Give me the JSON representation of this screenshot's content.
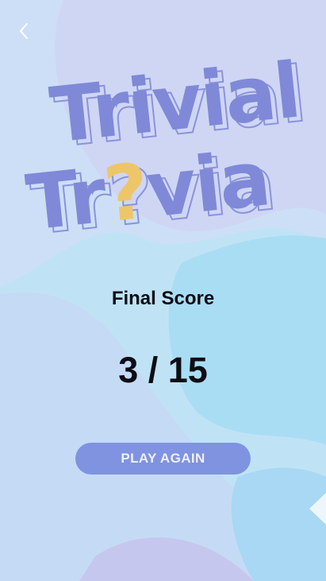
{
  "nav": {
    "back_icon": "chevron-left-icon"
  },
  "logo": {
    "line1": "Trivial",
    "line2_prefix": "Tr",
    "line2_mark": "?",
    "line2_suffix": "via"
  },
  "result": {
    "label": "Final Score",
    "score": "3 / 15"
  },
  "actions": {
    "play_again_label": "PLAY AGAIN"
  },
  "colors": {
    "logo_purple": "#7f89d8",
    "question_mark_yellow": "#edc66a",
    "button_fill": "#7f93e1",
    "button_text": "#eef0fb",
    "text_dark": "#0d0d14"
  }
}
